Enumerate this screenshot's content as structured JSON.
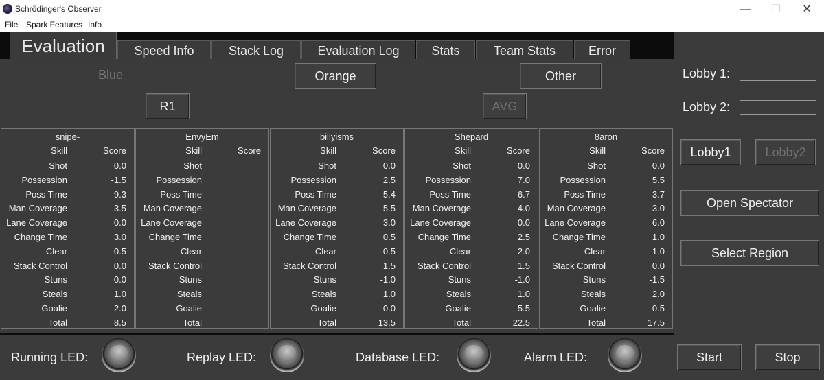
{
  "window": {
    "title": "Schrödinger's Observer",
    "minimize": "—",
    "maximize": "☐",
    "close": "✕"
  },
  "menu": [
    "File",
    "Spark Features",
    "Info"
  ],
  "tabs": [
    "Evaluation",
    "Speed Info",
    "Stack Log",
    "Evaluation Log",
    "Stats",
    "Team Stats",
    "Error"
  ],
  "teams": {
    "blue": "Blue",
    "orange": "Orange",
    "other": "Other",
    "r1": "R1",
    "avg": "AVG"
  },
  "columns": {
    "skill": "Skill",
    "score": "Score"
  },
  "skills": [
    "Shot",
    "Possession",
    "Poss Time",
    "Man Coverage",
    "Lane Coverage",
    "Change Time",
    "Clear",
    "Stack Control",
    "Stuns",
    "Steals",
    "Goalie",
    "Total"
  ],
  "players": [
    {
      "name": "snipe-",
      "scores": [
        "0.0",
        "-1.5",
        "9.3",
        "3.5",
        "0.0",
        "3.0",
        "0.5",
        "0.0",
        "0.0",
        "1.0",
        "2.0",
        "8.5"
      ]
    },
    {
      "name": "EnvyEm",
      "scores": [
        "",
        "",
        "",
        "",
        "",
        "",
        "",
        "",
        "",
        "",
        "",
        ""
      ]
    },
    {
      "name": "billyisms",
      "scores": [
        "0.0",
        "2.5",
        "5.4",
        "5.5",
        "3.0",
        "0.5",
        "0.5",
        "1.5",
        "-1.0",
        "1.0",
        "0.0",
        "13.5"
      ]
    },
    {
      "name": "Shepard",
      "scores": [
        "0.0",
        "7.0",
        "6.7",
        "4.0",
        "0.0",
        "2.5",
        "2.0",
        "1.5",
        "-1.0",
        "1.0",
        "5.5",
        "22.5"
      ]
    },
    {
      "name": "8aron",
      "scores": [
        "0.0",
        "5.5",
        "3.7",
        "3.0",
        "6.0",
        "1.0",
        "1.0",
        "0.0",
        "-1.5",
        "2.0",
        "0.5",
        "17.5"
      ]
    }
  ],
  "lobby": {
    "label1": "Lobby 1:",
    "label2": "Lobby 2:",
    "btn1": "Lobby1",
    "btn2": "Lobby2"
  },
  "actions": {
    "spectator": "Open Spectator",
    "region": "Select Region",
    "start": "Start",
    "stop": "Stop"
  },
  "leds": [
    "Running LED:",
    "Replay LED:",
    "Database LED:",
    "Alarm LED:"
  ]
}
